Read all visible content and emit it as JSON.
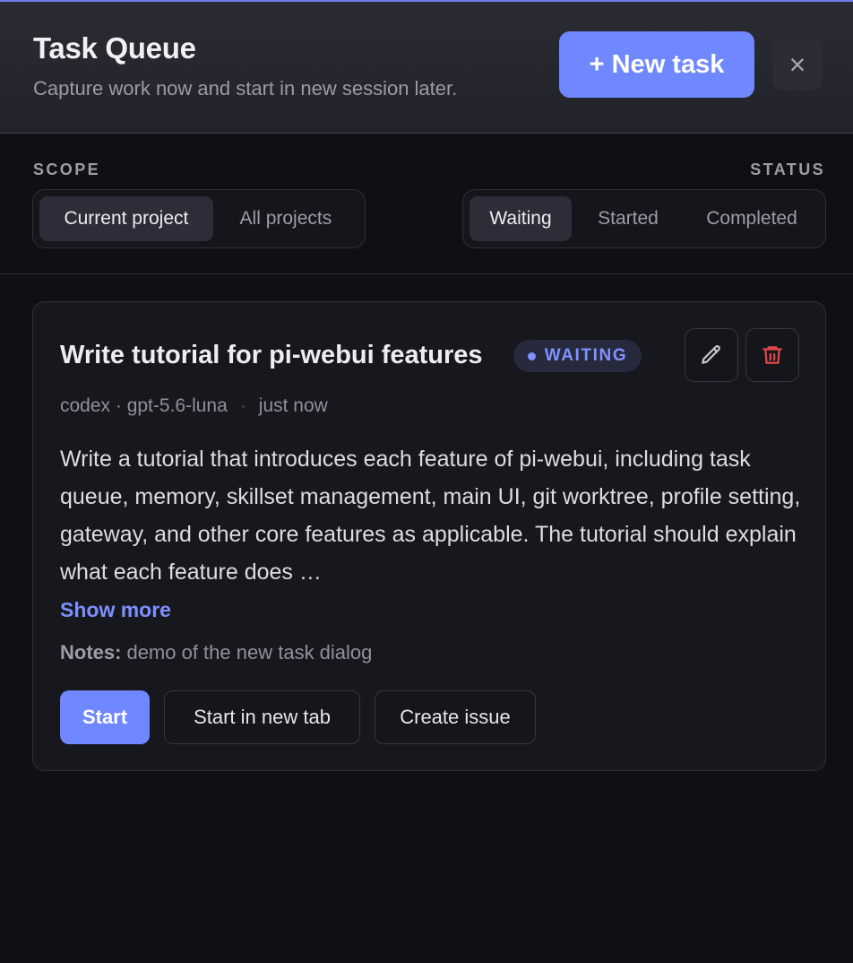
{
  "header": {
    "title": "Task Queue",
    "subtitle": "Capture work now and start in new session later.",
    "new_task_label": "+ New task",
    "close_glyph": "×"
  },
  "filters": {
    "scope": {
      "label": "SCOPE",
      "options": [
        "Current project",
        "All projects"
      ],
      "selected": "Current project"
    },
    "status": {
      "label": "STATUS",
      "options": [
        "Waiting",
        "Started",
        "Completed"
      ],
      "selected": "Waiting"
    }
  },
  "task": {
    "title": "Write tutorial for pi-webui features",
    "status_badge": "WAITING",
    "agent_model": "codex · gpt-5.6-luna",
    "meta_separator": "·",
    "time": "just now",
    "description": "Write a tutorial that introduces each feature of pi-webui, including task queue, memory, skillset management, main UI, git worktree, profile setting, gateway, and other core features as applicable. The tutorial should explain what each feature does …",
    "show_more_label": "Show more",
    "notes_label": "Notes:",
    "notes_value": "demo of the new task dialog",
    "actions": {
      "start": "Start",
      "start_new_tab": "Start in new tab",
      "create_issue": "Create issue"
    },
    "icons": [
      "pencil-icon",
      "trash-icon"
    ]
  },
  "colors": {
    "accent": "#6f87ff",
    "danger": "#e5484d",
    "background": "#101014",
    "card": "#17181d"
  }
}
